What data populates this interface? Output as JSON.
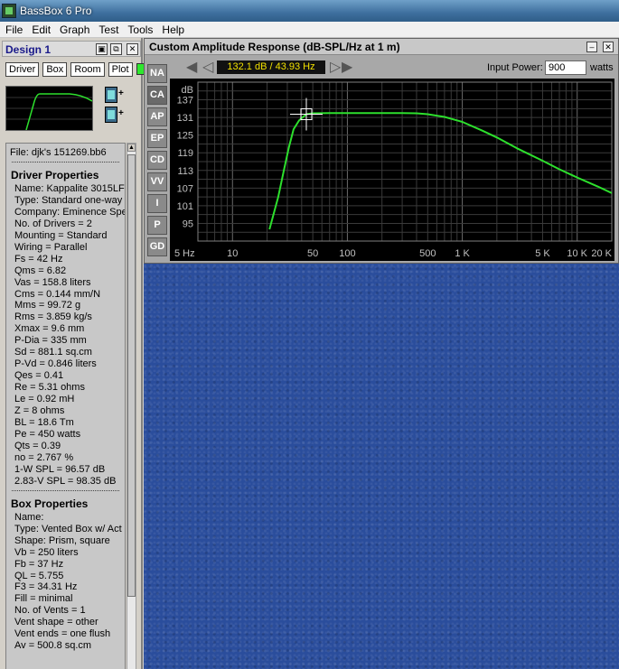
{
  "window": {
    "title": "BassBox 6 Pro"
  },
  "menu": [
    "File",
    "Edit",
    "Graph",
    "Test",
    "Tools",
    "Help"
  ],
  "design": {
    "title": "Design 1",
    "tabs": [
      "Driver",
      "Box",
      "Room",
      "Plot"
    ],
    "file_label": "File:  djk's 151269.bb6",
    "driver_heading": "Driver Properties",
    "driver_props": [
      "Name: Kappalite 3015LF",
      "Type: Standard one-way c",
      "Company: Eminence Spea",
      "No. of Drivers = 2",
      "Mounting = Standard",
      "Wiring = Parallel",
      "Fs =  42 Hz",
      "Qms =  6.82",
      "Vas =  158.8 liters",
      "Cms =  0.144 mm/N",
      "Mms =  99.72 g",
      "Rms =  3.859 kg/s",
      "Xmax =  9.6 mm",
      "P-Dia =  335 mm",
      "Sd =  881.1 sq.cm",
      "P-Vd =  0.846 liters",
      "Qes =  0.41",
      "Re =  5.31 ohms",
      "Le =  0.92 mH",
      "Z =  8 ohms",
      "BL =  18.6 Tm",
      "Pe =  450 watts",
      "Qts =  0.39",
      "no =  2.767 %",
      "1-W SPL =  96.57 dB",
      "2.83-V SPL =  98.35 dB"
    ],
    "box_heading": "Box Properties",
    "box_props": [
      "Name:",
      "Type: Vented Box w/ Act",
      "Shape: Prism, square",
      "Vb =  250 liters",
      "Fb =  37 Hz",
      "QL =  5.755",
      "F3 =  34.31 Hz",
      "Fill = minimal",
      "No. of Vents = 1",
      "Vent shape = other",
      "Vent ends = one flush",
      "Av =  500.8 sq.cm"
    ]
  },
  "graph": {
    "title": "Custom Amplitude Response (dB-SPL/Hz at 1 m)",
    "side_tabs": [
      "NA",
      "CA",
      "AP",
      "EP",
      "CD",
      "VV",
      "I",
      "P",
      "GD"
    ],
    "active_tab": "CA",
    "readout": "132.1 dB / 43.93 Hz",
    "input_power_label": "Input Power:",
    "input_power_value": "900",
    "input_power_unit": "watts"
  },
  "colors": {
    "curve": "#2de02d",
    "readout_text": "#f2e100",
    "desktop": "#2a4d9c"
  },
  "chart_data": {
    "type": "line",
    "ylabel": "dB",
    "xscale": "log",
    "xlim": [
      5,
      20000
    ],
    "ylim": [
      89,
      143
    ],
    "yticks": [
      137,
      131,
      125,
      119,
      113,
      107,
      101,
      95
    ],
    "xticks": [
      {
        "v": 5,
        "label": "5 Hz"
      },
      {
        "v": 10,
        "label": "10"
      },
      {
        "v": 50,
        "label": "50"
      },
      {
        "v": 100,
        "label": "100"
      },
      {
        "v": 500,
        "label": "500"
      },
      {
        "v": 1000,
        "label": "1 K"
      },
      {
        "v": 5000,
        "label": "5 K"
      },
      {
        "v": 10000,
        "label": "10 K"
      },
      {
        "v": 20000,
        "label": "20 K"
      }
    ],
    "series": [
      {
        "x": [
          21,
          25,
          28,
          31,
          34,
          38,
          43.93,
          50,
          70,
          100,
          200,
          300,
          400,
          500,
          700,
          1000,
          1500,
          2000,
          3000,
          5000,
          7000,
          10000,
          15000,
          20000
        ],
        "y": [
          93,
          104,
          113,
          121,
          127,
          130,
          132.1,
          132.4,
          132.5,
          132.5,
          132.5,
          132.5,
          132.4,
          132.1,
          131.2,
          129.5,
          126.5,
          124.2,
          120.5,
          116.3,
          113.4,
          110.6,
          107.6,
          105.3
        ]
      }
    ],
    "cursor": {
      "x": 43.93,
      "y": 132.1
    }
  }
}
